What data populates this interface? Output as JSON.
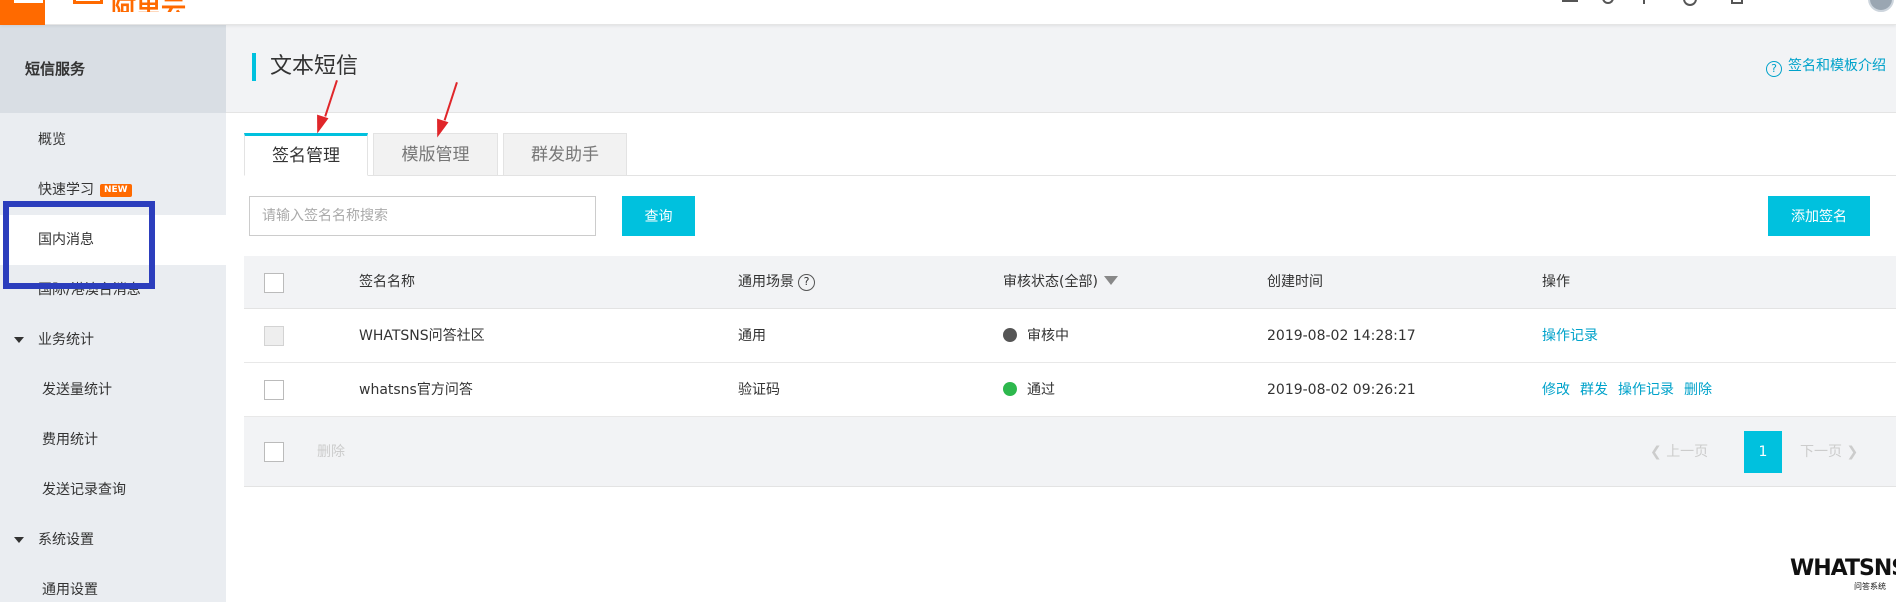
{
  "topbar": {
    "logo_text": "阿里云"
  },
  "sidebar": {
    "header": "短信服务",
    "items": [
      {
        "label": "概览"
      },
      {
        "label": "快速学习",
        "badge": "NEW"
      },
      {
        "label": "国内消息"
      },
      {
        "label": "国际/港澳台消息"
      }
    ],
    "group_business": "业务统计",
    "business_items": [
      "发送量统计",
      "费用统计",
      "发送记录查询"
    ],
    "group_settings": "系统设置",
    "settings_items": [
      "通用设置"
    ]
  },
  "page": {
    "title": "文本短信",
    "help_link": "签名和模板介绍",
    "help_icon": "?"
  },
  "tabs": [
    "签名管理",
    "模版管理",
    "群发助手"
  ],
  "search": {
    "placeholder": "请输入签名名称搜索",
    "query_button": "查询",
    "add_button": "添加签名"
  },
  "table": {
    "headers": {
      "name": "签名名称",
      "scene": "通用场景",
      "scene_help": "?",
      "status": "审核状态(全部)",
      "created": "创建时间",
      "actions": "操作"
    },
    "rows": [
      {
        "name": "WHATSNS问答社区",
        "scene": "通用",
        "status": "审核中",
        "status_color": "#555555",
        "created": "2019-08-02 14:28:17",
        "actions": [
          "操作记录"
        ]
      },
      {
        "name": "whatsns官方问答",
        "scene": "验证码",
        "status": "通过",
        "status_color": "#2db84d",
        "created": "2019-08-02 09:26:21",
        "actions": [
          "修改",
          "群发",
          "操作记录",
          "删除"
        ]
      }
    ],
    "delete_button": "删除"
  },
  "pager": {
    "prev": "上一页",
    "current": "1",
    "next": "下一页"
  },
  "watermark": {
    "big": "WHATSNS",
    "small": "问答系统"
  },
  "colors": {
    "accent": "#00c1de",
    "brand": "#ff6a00",
    "link": "#00a2ca",
    "annotation_box": "#2c3ebd",
    "annotation_arrow": "#e0262a"
  }
}
